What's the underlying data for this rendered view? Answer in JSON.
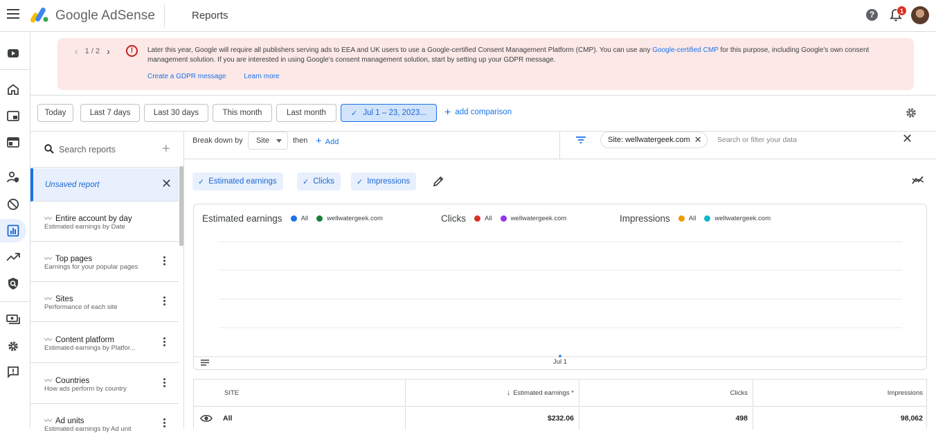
{
  "app": {
    "brand": "Google AdSense",
    "page_title": "Reports",
    "notification_count": "1",
    "help_glyph": "?"
  },
  "banner": {
    "pager": "1 / 2",
    "text_before": "Later this year, Google will require all publishers serving ads to EEA and UK users to use a Google-certified Consent Management Platform (CMP). You can use any ",
    "link_text": "Google-certified CMP",
    "text_after": " for this purpose, including Google's own consent management solution. If you are interested in using Google's consent management solution, start by setting up your GDPR message.",
    "action_primary": "Create a GDPR message",
    "action_secondary": "Learn more",
    "color": "#fce8e6"
  },
  "date_ranges": [
    "Today",
    "Last 7 days",
    "Last 30 days",
    "This month",
    "Last month"
  ],
  "date_selected": "Jul 1 – 23, 2023...",
  "add_comparison": "add comparison",
  "reports_panel": {
    "search_placeholder": "Search reports",
    "unsaved": "Unsaved report",
    "items": [
      {
        "title": "Entire account by day",
        "subtitle": "Estimated earnings by Date"
      },
      {
        "title": "Top pages",
        "subtitle": "Earnings for your popular pages"
      },
      {
        "title": "Sites",
        "subtitle": "Performance of each site"
      },
      {
        "title": "Content platform",
        "subtitle": "Estimated earnings by Platfor..."
      },
      {
        "title": "Countries",
        "subtitle": "How ads perform by country"
      },
      {
        "title": "Ad units",
        "subtitle": "Estimated earnings by Ad unit"
      }
    ]
  },
  "breakdown": {
    "label": "Break down by",
    "dimension": "Site",
    "then": "then",
    "add": "Add"
  },
  "filter": {
    "chip": "Site: wellwatergeek.com",
    "placeholder": "Search or filter your data"
  },
  "metrics": [
    "Estimated earnings",
    "Clicks",
    "Impressions"
  ],
  "legend": {
    "groups": [
      {
        "title": "Estimated earnings",
        "items": [
          {
            "label": "All",
            "color": "#1a73e8"
          },
          {
            "label": "wellwatergeek.com",
            "color": "#188038"
          }
        ]
      },
      {
        "title": "Clicks",
        "items": [
          {
            "label": "All",
            "color": "#d93025"
          },
          {
            "label": "wellwatergeek.com",
            "color": "#9334e6"
          }
        ]
      },
      {
        "title": "Impressions",
        "items": [
          {
            "label": "All",
            "color": "#f29900"
          },
          {
            "label": "wellwatergeek.com",
            "color": "#12b5cb"
          }
        ]
      }
    ]
  },
  "chart": {
    "x_tick": "Jul 1"
  },
  "table": {
    "headers": {
      "site": "SITE",
      "earnings": "Estimated earnings *",
      "clicks": "Clicks",
      "impressions": "Impressions"
    },
    "rows": [
      {
        "site": "All",
        "earnings": "$232.06",
        "clicks": "498",
        "impressions": "98,062"
      }
    ]
  }
}
